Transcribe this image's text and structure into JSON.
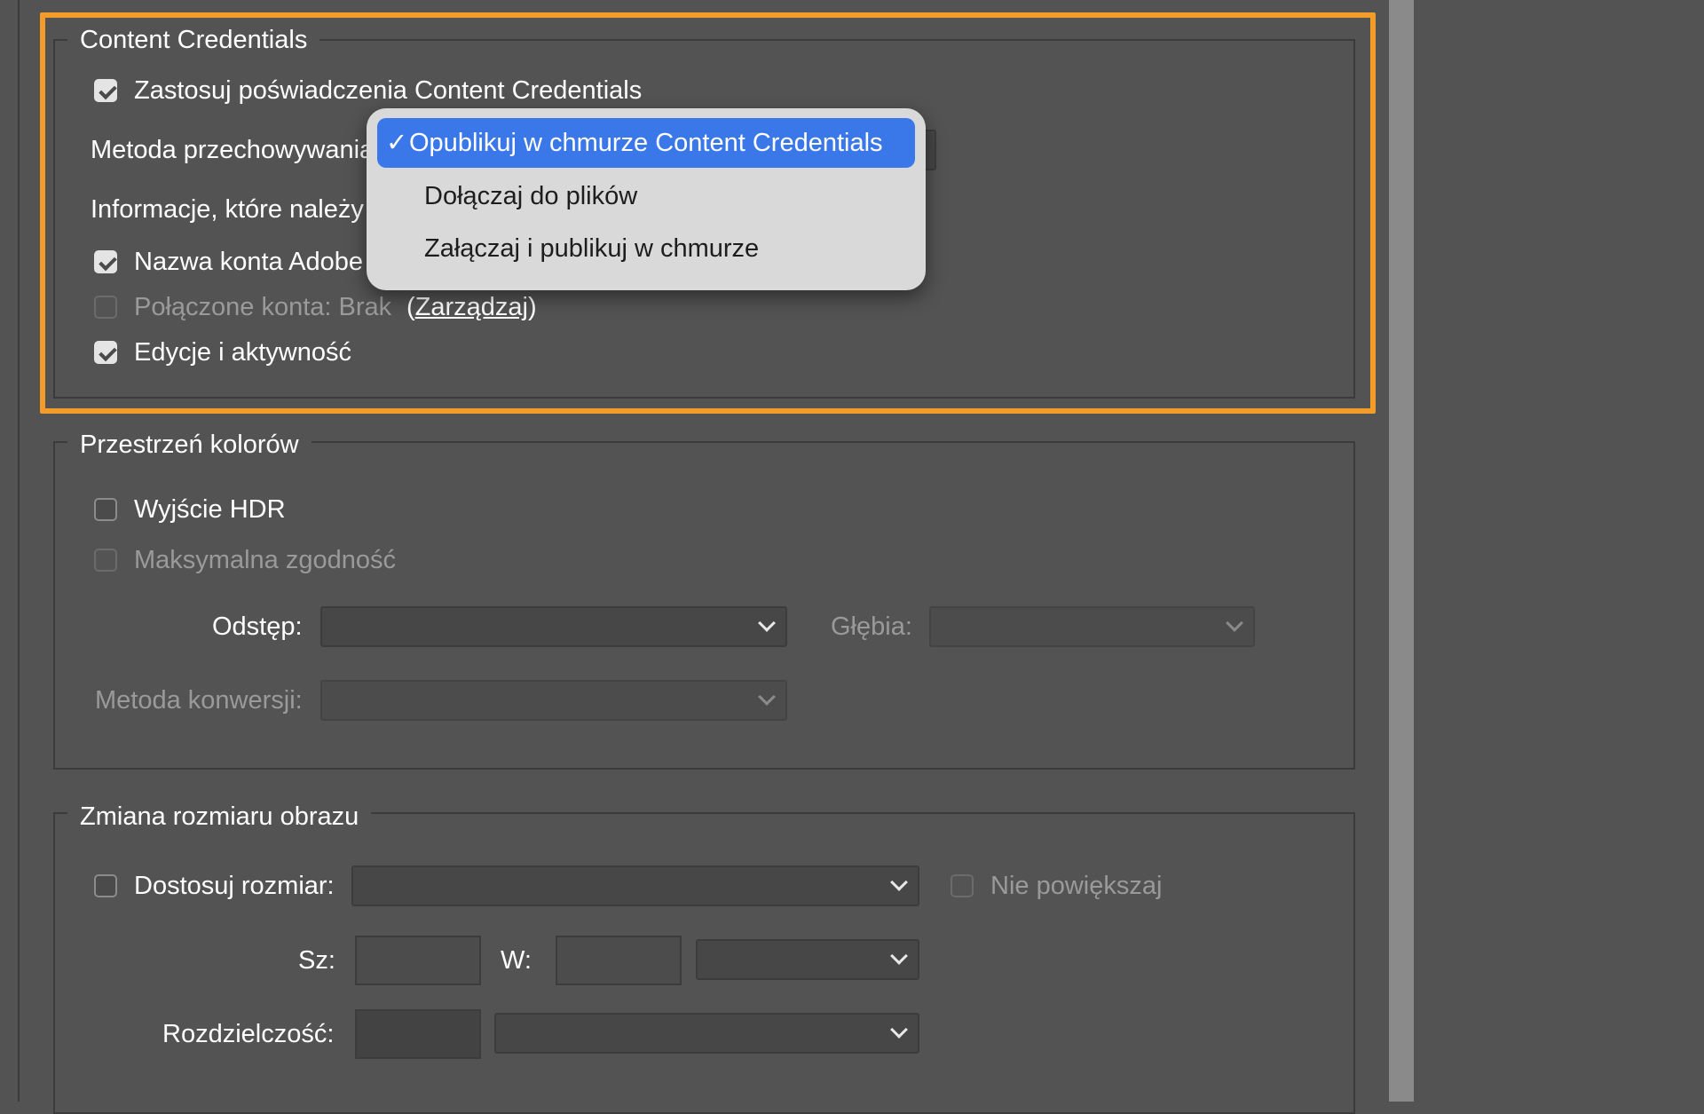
{
  "content_credentials": {
    "legend": "Content Credentials",
    "apply_label": "Zastosuj poświadczenia Content Credentials",
    "apply_checked": true,
    "storage_label": "Metoda przechowywania:",
    "info_label": "Informacje, które należy uwzględnić:",
    "adobe_account_label": "Nazwa konta Adobe",
    "adobe_account_checked": true,
    "connected_accounts_label": "Połączone konta: Brak",
    "connected_accounts_checked": false,
    "manage_open": "(",
    "manage_link": "Zarządzaj",
    "manage_close": ")",
    "edits_label": "Edycje i aktywność",
    "edits_checked": true
  },
  "storage_menu": {
    "check_glyph": "✓",
    "items": [
      "Opublikuj w chmurze Content Credentials",
      "Dołączaj do plików",
      "Załączaj i publikuj w chmurze"
    ],
    "selected_index": 0
  },
  "color_space": {
    "legend": "Przestrzeń kolorów",
    "hdr_label": "Wyjście HDR",
    "max_compat_label": "Maksymalna zgodność",
    "spacing_label": "Odstęp:",
    "depth_label": "Głębia:",
    "conversion_label": "Metoda konwersji:"
  },
  "resize": {
    "legend": "Zmiana rozmiaru obrazu",
    "fit_label": "Dostosuj rozmiar:",
    "no_enlarge_label": "Nie powiększaj",
    "width_label": "Sz:",
    "height_label": "W:",
    "resolution_label": "Rozdzielczość:"
  },
  "colors": {
    "highlight": "#f39c2a",
    "menu_selected": "#3a78ea",
    "background": "#535353"
  }
}
